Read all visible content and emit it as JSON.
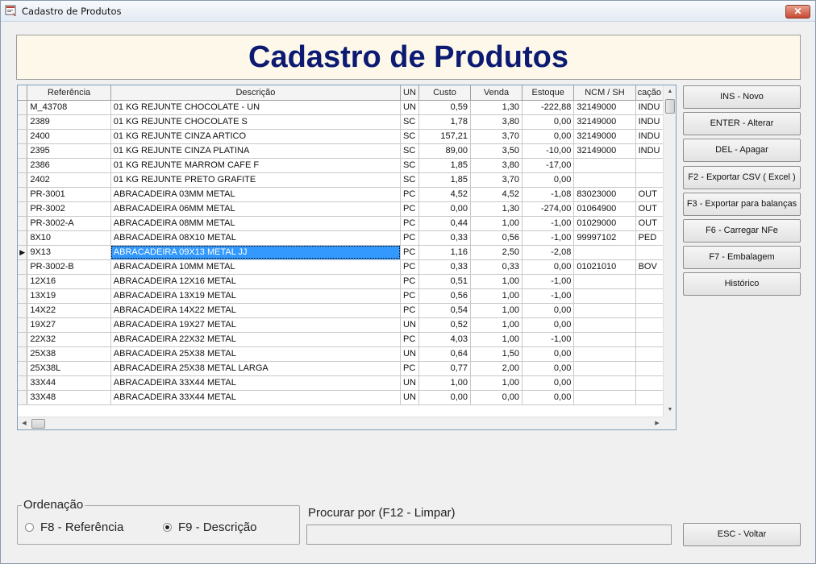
{
  "window": {
    "title": "Cadastro de Produtos",
    "close_label": "✕"
  },
  "banner": {
    "title": "Cadastro de Produtos"
  },
  "grid": {
    "columns": [
      "Referência",
      "Descrição",
      "UN",
      "Custo",
      "Venda",
      "Estoque",
      "NCM / SH",
      "cação"
    ],
    "selected_index": 10,
    "rows": [
      [
        "M_43708",
        "01 KG REJUNTE CHOCOLATE - UN",
        "UN",
        "0,59",
        "1,30",
        "-222,88",
        "32149000",
        "INDU"
      ],
      [
        "2389",
        "01 KG REJUNTE CHOCOLATE S",
        "SC",
        "1,78",
        "3,80",
        "0,00",
        "32149000",
        "INDU"
      ],
      [
        "2400",
        "01 KG REJUNTE CINZA ARTICO",
        "SC",
        "157,21",
        "3,70",
        "0,00",
        "32149000",
        "INDU"
      ],
      [
        "2395",
        "01 KG REJUNTE CINZA PLATINA",
        "SC",
        "89,00",
        "3,50",
        "-10,00",
        "32149000",
        "INDU"
      ],
      [
        "2386",
        "01 KG REJUNTE MARROM CAFE F",
        "SC",
        "1,85",
        "3,80",
        "-17,00",
        "",
        ""
      ],
      [
        "2402",
        "01 KG REJUNTE PRETO GRAFITE",
        "SC",
        "1,85",
        "3,70",
        "0,00",
        "",
        ""
      ],
      [
        "PR-3001",
        "ABRACADEIRA 03MM METAL",
        "PC",
        "4,52",
        "4,52",
        "-1,08",
        "83023000",
        "OUT"
      ],
      [
        "PR-3002",
        "ABRACADEIRA 06MM METAL",
        "PC",
        "0,00",
        "1,30",
        "-274,00",
        "01064900",
        "OUT"
      ],
      [
        "PR-3002-A",
        "ABRACADEIRA 08MM METAL",
        "PC",
        "0,44",
        "1,00",
        "-1,00",
        "01029000",
        "OUT"
      ],
      [
        "8X10",
        "ABRACADEIRA 08X10 METAL",
        "PC",
        "0,33",
        "0,56",
        "-1,00",
        "99997102",
        "PED"
      ],
      [
        "9X13",
        "ABRACADEIRA 09X13 METAL JJ",
        "PC",
        "1,16",
        "2,50",
        "-2,08",
        "",
        ""
      ],
      [
        "PR-3002-B",
        "ABRACADEIRA 10MM METAL",
        "PC",
        "0,33",
        "0,33",
        "0,00",
        "01021010",
        "BOV"
      ],
      [
        "12X16",
        "ABRACADEIRA 12X16 METAL",
        "PC",
        "0,51",
        "1,00",
        "-1,00",
        "",
        ""
      ],
      [
        "13X19",
        "ABRACADEIRA 13X19 METAL",
        "PC",
        "0,56",
        "1,00",
        "-1,00",
        "",
        ""
      ],
      [
        "14X22",
        "ABRACADEIRA 14X22 METAL",
        "PC",
        "0,54",
        "1,00",
        "0,00",
        "",
        ""
      ],
      [
        "19X27",
        "ABRACADEIRA 19X27 METAL",
        "UN",
        "0,52",
        "1,00",
        "0,00",
        "",
        ""
      ],
      [
        "22X32",
        "ABRACADEIRA 22X32 METAL",
        "PC",
        "4,03",
        "1,00",
        "-1,00",
        "",
        ""
      ],
      [
        "25X38",
        "ABRACADEIRA 25X38 METAL",
        "UN",
        "0,64",
        "1,50",
        "0,00",
        "",
        ""
      ],
      [
        "25X38L",
        "ABRACADEIRA 25X38 METAL LARGA",
        "PC",
        "0,77",
        "2,00",
        "0,00",
        "",
        ""
      ],
      [
        "33X44",
        "ABRACADEIRA 33X44 METAL",
        "UN",
        "1,00",
        "1,00",
        "0,00",
        "",
        ""
      ],
      [
        "33X48",
        "ABRACADEIRA 33X44 METAL",
        "UN",
        "0,00",
        "0,00",
        "0,00",
        "",
        ""
      ]
    ]
  },
  "buttons": {
    "novo": "INS - Novo",
    "alterar": "ENTER - Alterar",
    "apagar": "DEL - Apagar",
    "exportar_csv": "F2 - Exportar CSV ( Excel )",
    "exportar_balancas": "F3 - Exportar para balanças",
    "carregar_nfe": "F6 - Carregar NFe",
    "embalagem": "F7 - Embalagem",
    "historico": "Histórico",
    "voltar": "ESC - Voltar"
  },
  "ordenacao": {
    "title": "Ordenação",
    "options": [
      "F8 - Referência",
      "F9 - Descrição"
    ],
    "selected": "F9 - Descrição"
  },
  "search": {
    "label": "Procurar por (F12 - Limpar)",
    "value": ""
  },
  "icons": {
    "indicator": "row-pointer-icon",
    "scroll_up": "arrow-up-icon",
    "scroll_down": "arrow-down-icon",
    "scroll_left": "arrow-left-icon",
    "scroll_right": "arrow-right-icon"
  }
}
